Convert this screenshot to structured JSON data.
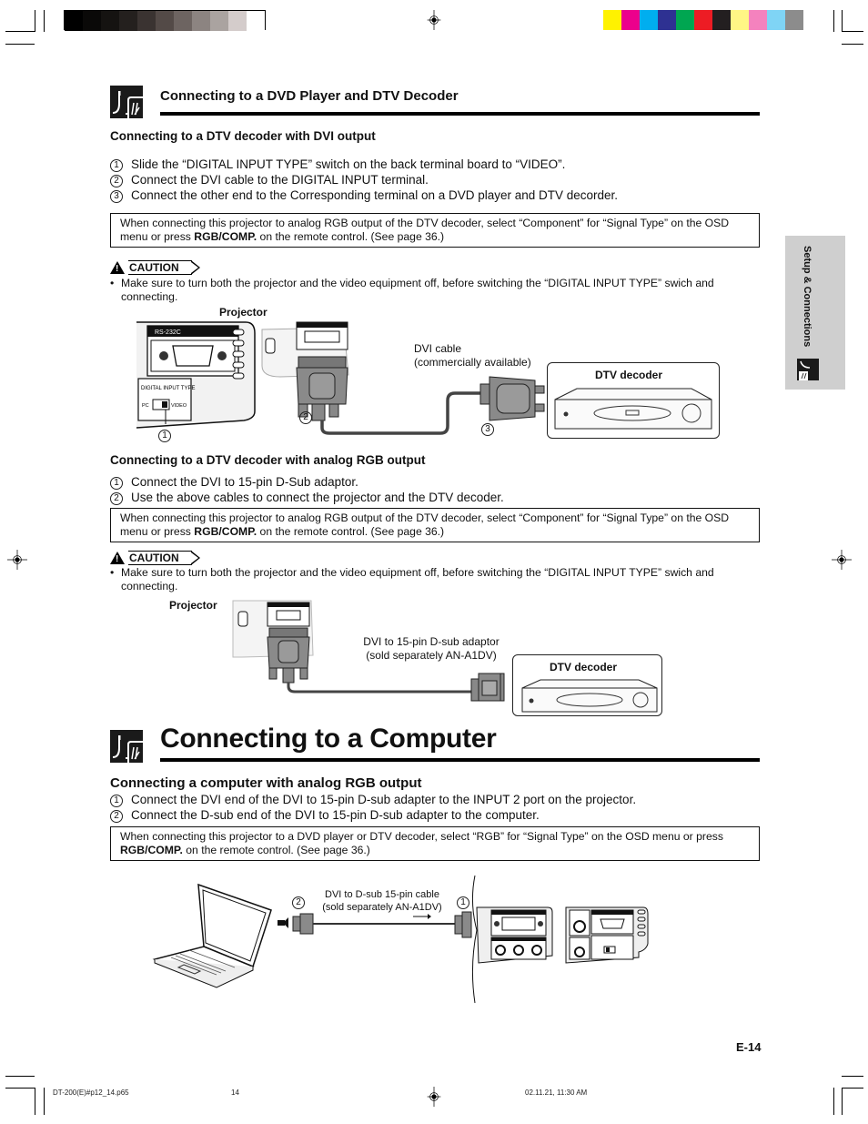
{
  "print_marks": {
    "grayscale_swatches": [
      "#000000",
      "#0a0908",
      "#151311",
      "#24201e",
      "#3a3331",
      "#534a47",
      "#6d6461",
      "#8c8481",
      "#aaa3a0",
      "#d4cccb",
      "#ffffff"
    ],
    "color_swatches": [
      "#fff200",
      "#ec008c",
      "#00aeef",
      "#2e3192",
      "#00a651",
      "#ed1c24",
      "#231f20",
      "#fff685",
      "#f482be",
      "#7fd4f5",
      "#8c8c8c"
    ]
  },
  "section1": {
    "title": "Connecting to a DVD Player and DTV Decoder",
    "icon": "cable-connection-icon",
    "dvi": {
      "heading": "Connecting to a DTV decoder with DVI output",
      "steps": [
        {
          "num": "1",
          "text": "Slide the “DIGITAL INPUT TYPE” switch on the back terminal board to “VIDEO”."
        },
        {
          "num": "2",
          "text": "Connect the DVI cable to the DIGITAL INPUT terminal."
        },
        {
          "num": "3",
          "text": "Connect the other end to the Corresponding terminal on a DVD player and DTV decorder."
        }
      ],
      "note_pre": "When connecting this projector to analog RGB output of the DTV decoder, select “Component” for “Signal Type” on the OSD menu or press ",
      "note_bold": "RGB/COMP.",
      "note_post": " on the remote control. (See page 36.)",
      "caution_label": "CAUTION",
      "caution_text": "Make sure to turn both the projector and the video equipment off, before switching the “DIGITAL INPUT TYPE” swich and connecting.",
      "diagram": {
        "projector_label": "Projector",
        "rs232c_label": "RS-232C",
        "digital_input_type_label": "DIGITAL INPUT TYPE",
        "pc_label": "PC",
        "video_label": "VIDEO",
        "cable_label_line1": "DVI cable",
        "cable_label_line2": "(commercially available)",
        "decoder_label": "DTV decoder",
        "callouts": [
          "1",
          "2",
          "3"
        ]
      }
    },
    "analog": {
      "heading": "Connecting to a DTV decoder with analog RGB output",
      "steps": [
        {
          "num": "1",
          "text": "Connect the DVI to 15-pin D-Sub adaptor."
        },
        {
          "num": "2",
          "text": "Use the above cables to connect the projector and the DTV decoder."
        }
      ],
      "note_pre": "When connecting this projector to analog RGB output of the DTV decoder, select “Component” for “Signal Type” on the OSD menu or press ",
      "note_bold": "RGB/COMP.",
      "note_post": " on the remote control. (See page 36.)",
      "caution_label": "CAUTION",
      "caution_text": "Make sure to turn both the projector and the video equipment off, before switching the “DIGITAL INPUT TYPE” swich and connecting.",
      "diagram": {
        "projector_label": "Projector",
        "adaptor_label_line1": "DVI to 15-pin D-sub adaptor",
        "adaptor_label_line2": "(sold separately AN-A1DV)",
        "decoder_label": "DTV decoder"
      }
    }
  },
  "section2": {
    "title": "Connecting to a Computer",
    "icon": "cable-connection-icon",
    "heading": "Connecting a computer with analog RGB output",
    "steps": [
      {
        "num": "1",
        "text": "Connect the DVI end of the DVI to 15-pin D-sub adapter to the INPUT 2 port on the projector."
      },
      {
        "num": "2",
        "text": "Connect the D-sub end of the DVI to 15-pin D-sub adapter to the computer."
      }
    ],
    "note_pre": "When connecting this projector to a DVD player or DTV decoder, select “RGB” for “Signal Type” on the OSD menu or press ",
    "note_bold": "RGB/COMP.",
    "note_post": " on the remote control. (See page 36.)",
    "diagram": {
      "cable_label_line1": "DVI to D-sub 15-pin cable",
      "cable_label_line2": "(sold separately AN-A1DV)",
      "callouts": [
        "2",
        "1"
      ]
    }
  },
  "side_tab": {
    "label": "Setup & Connections",
    "icon": "cable-connection-icon"
  },
  "page_number": "E-14",
  "footer": {
    "file": "DT-200(E)#p12_14.p65",
    "page": "14",
    "timestamp": "02.11.21, 11:30 AM"
  }
}
